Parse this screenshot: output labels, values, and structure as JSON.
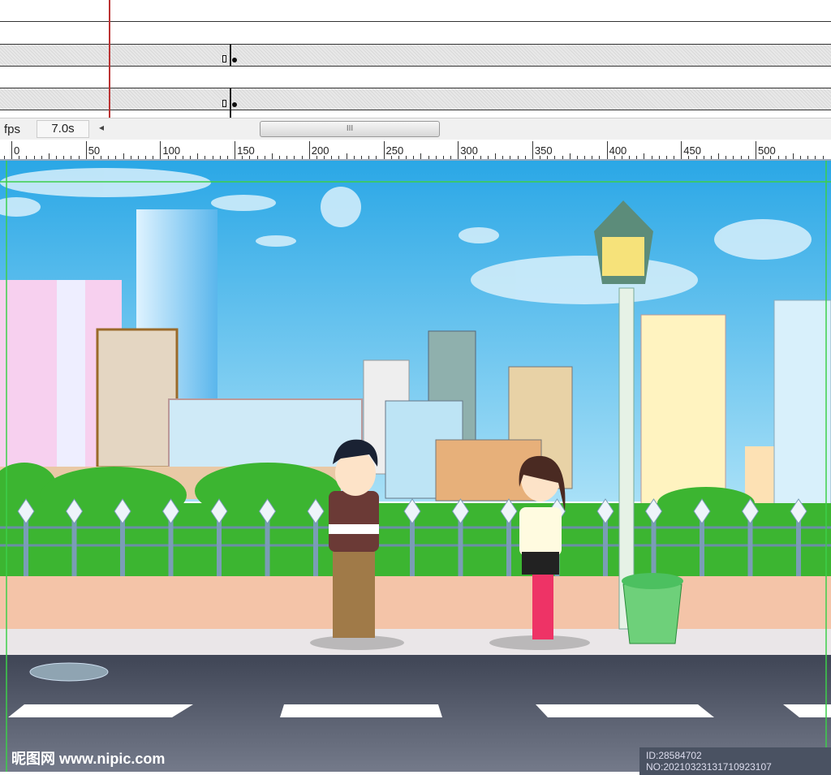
{
  "timeline": {
    "fps_label": "fps",
    "time": "7.0s",
    "scroll_grip": "III",
    "prev_arrow": "◂"
  },
  "ruler": {
    "labels": [
      "0",
      "50",
      "100",
      "150",
      "200",
      "250",
      "300",
      "350",
      "400",
      "450",
      "500"
    ]
  },
  "watermark": {
    "site": "昵图网 www.nipic.com",
    "id": "ID:28584702 NO:20210323131710923107"
  },
  "colors": {
    "sky": "#3fb6ec",
    "road": "#4a5060",
    "sidewalk": "#f4c4a8",
    "grass": "#3db53a"
  }
}
